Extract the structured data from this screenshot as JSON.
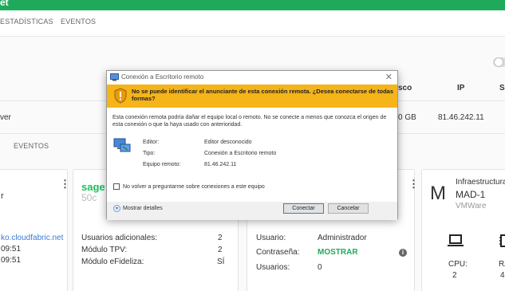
{
  "app": {
    "title_fragment": "et"
  },
  "tabs": [
    {
      "label": "ESTADÍSTICAS"
    },
    {
      "label": "EVENTOS"
    }
  ],
  "table": {
    "headers": {
      "disk_fragment": "sco",
      "ip": "IP",
      "last_fragment": "S"
    },
    "row": {
      "name_fragment": "ver",
      "disk_fragment": "0 GB",
      "ip": "81.46.242.11"
    }
  },
  "subtabs": {
    "events": "EVENTOS"
  },
  "card1": {
    "r_fragment": "r",
    "link_fragment": "ko.cloudfabric.net",
    "time1": "09:51",
    "time2": "09:51"
  },
  "card2": {
    "brand": "sage",
    "brand_sub": "50c",
    "rows": [
      {
        "label": "Usuarios adicionales:",
        "value": "2"
      },
      {
        "label": "Módulo TPV:",
        "value": "2"
      },
      {
        "label": "Módulo eFideliza:",
        "value": "SÍ"
      }
    ]
  },
  "card3": {
    "rows": [
      {
        "label": "Usuario:",
        "value": "Administrador"
      },
      {
        "label": "Contraseña:",
        "value": "MOSTRAR"
      },
      {
        "label": "Usuarios:",
        "value": "0"
      }
    ]
  },
  "card4": {
    "letter": "M",
    "title": "Infraestructura:",
    "name": "MAD-1",
    "platform": "VMWare",
    "cpu_label": "CPU:",
    "cpu_value": "2",
    "ram_label": "RA",
    "ram_value": "4"
  },
  "dialog": {
    "title": "Conexión a Escritorio remoto",
    "close": "✕",
    "warning": "No se puede identificar el anunciante de esta conexión remota. ¿Desea conectarse de todas formas?",
    "description": "Esta conexión remota podría dañar el equipo local o remoto. No se conecte a menos que conozca el origen de esta conexión o que la haya usado con anterioridad.",
    "fields": [
      {
        "label": "Editor:",
        "value": "Editor desconocido"
      },
      {
        "label": "Tipo:",
        "value": "Conexión a Escritorio remoto"
      },
      {
        "label": "Equipo remoto:",
        "value": "81.46.242.11"
      }
    ],
    "checkbox_label": "No volver a preguntarme sobre conexiones a este equipo",
    "details_label": "Mostrar detalles",
    "connect_label": "Conectar",
    "cancel_label": "Cancelar"
  },
  "colors": {
    "brand_green": "#1faa5b",
    "warning_yellow": "#f4b41a",
    "link_blue": "#3b7bd6"
  },
  "icons": [
    "shield-warning-icon",
    "remote-desktop-icon",
    "info-icon",
    "laptop-icon",
    "chip-icon",
    "chevron-down-icon",
    "kebab-menu-icon"
  ]
}
